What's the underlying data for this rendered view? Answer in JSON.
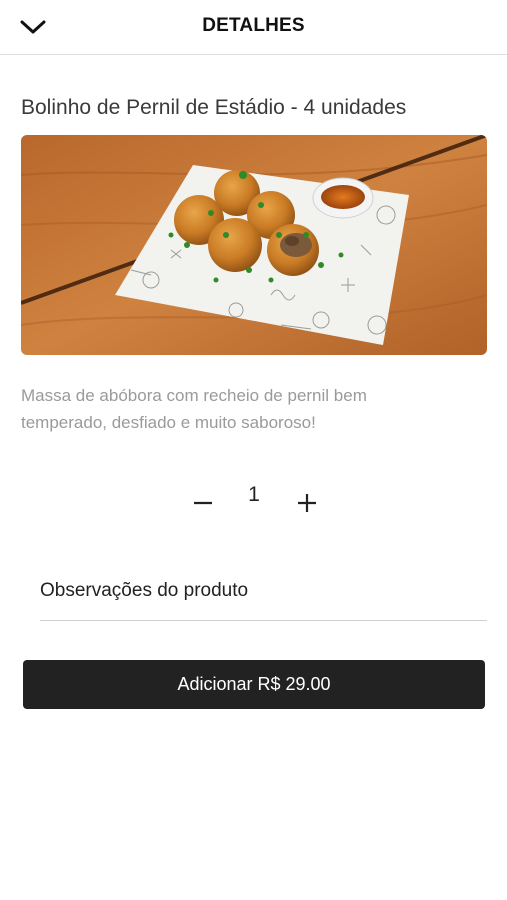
{
  "header": {
    "title": "DETALHES",
    "back_icon": "chevron-down-icon"
  },
  "product": {
    "title": "Bolinho de Pernil de Estádio - 4 unidades",
    "image_icon": "food-photo",
    "description": "Massa de abóbora com recheio de pernil bem temperado, desfiado e muito saboroso!"
  },
  "quantity": {
    "minus_icon": "minus-icon",
    "value": "1",
    "plus_icon": "plus-icon"
  },
  "observations": {
    "label": "Observações do produto"
  },
  "add_button": {
    "label": "Adicionar R$ 29.00"
  },
  "colors": {
    "button_bg": "#222222",
    "description_text": "#9a9a9a",
    "divider": "#dcdcdc"
  }
}
